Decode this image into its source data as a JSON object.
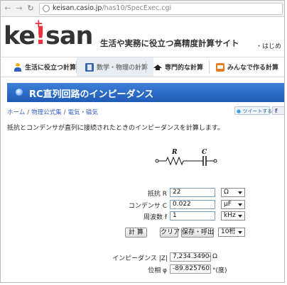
{
  "browser": {
    "url_domain": "keisan.casio.jp",
    "url_path": "/has10/SpecExec.cgi"
  },
  "header": {
    "logo_pre": "ke",
    "logo_bang": "!",
    "logo_post": "san",
    "logo_plus": "+",
    "tagline": "生活や実務に役立つ高精度計算サイト",
    "link_partial": "・はじめ"
  },
  "tabs": [
    {
      "label": "生活に役立つ計算",
      "icon": "person-icon"
    },
    {
      "label": "数学・物理の計算",
      "icon": "book-icon",
      "active": true
    },
    {
      "label": "専門的な計算",
      "icon": "graduation-cap-icon"
    },
    {
      "label": "みんなで作る計算",
      "icon": "share-icon"
    }
  ],
  "page": {
    "title": "RC直列回路のインピーダンス",
    "breadcrumb": [
      "ホーム",
      "物理公式集",
      "電気・磁気"
    ],
    "tweet_label": "ツイートする",
    "fb_label": "f",
    "description": "抵抗とコンデンサが直列に接続されたときのインピーダンスを計算します。"
  },
  "circuit": {
    "r_label": "R",
    "c_label": "C"
  },
  "form": {
    "resistance": {
      "label": "抵抗 R",
      "value": "22",
      "unit": "Ω"
    },
    "capacitance": {
      "label": "コンデンサ C",
      "value": "0.022",
      "unit": "μF"
    },
    "frequency": {
      "label": "周波数 f",
      "value": "1",
      "unit": "kHz"
    },
    "calc_button": "計 算",
    "clear_button": "クリア",
    "save_button": "保存・呼出",
    "digits": "10桁"
  },
  "results": {
    "impedance": {
      "label": "インピーダンス |Z|",
      "value": "7,234.349047",
      "unit": "Ω"
    },
    "phase": {
      "label": "位相 φ",
      "value": "-89.82576054",
      "unit": "°(度)"
    }
  },
  "colors": {
    "accent": "#1f5cb6",
    "logo_red": "#e8323c",
    "link": "#3b63c4"
  }
}
